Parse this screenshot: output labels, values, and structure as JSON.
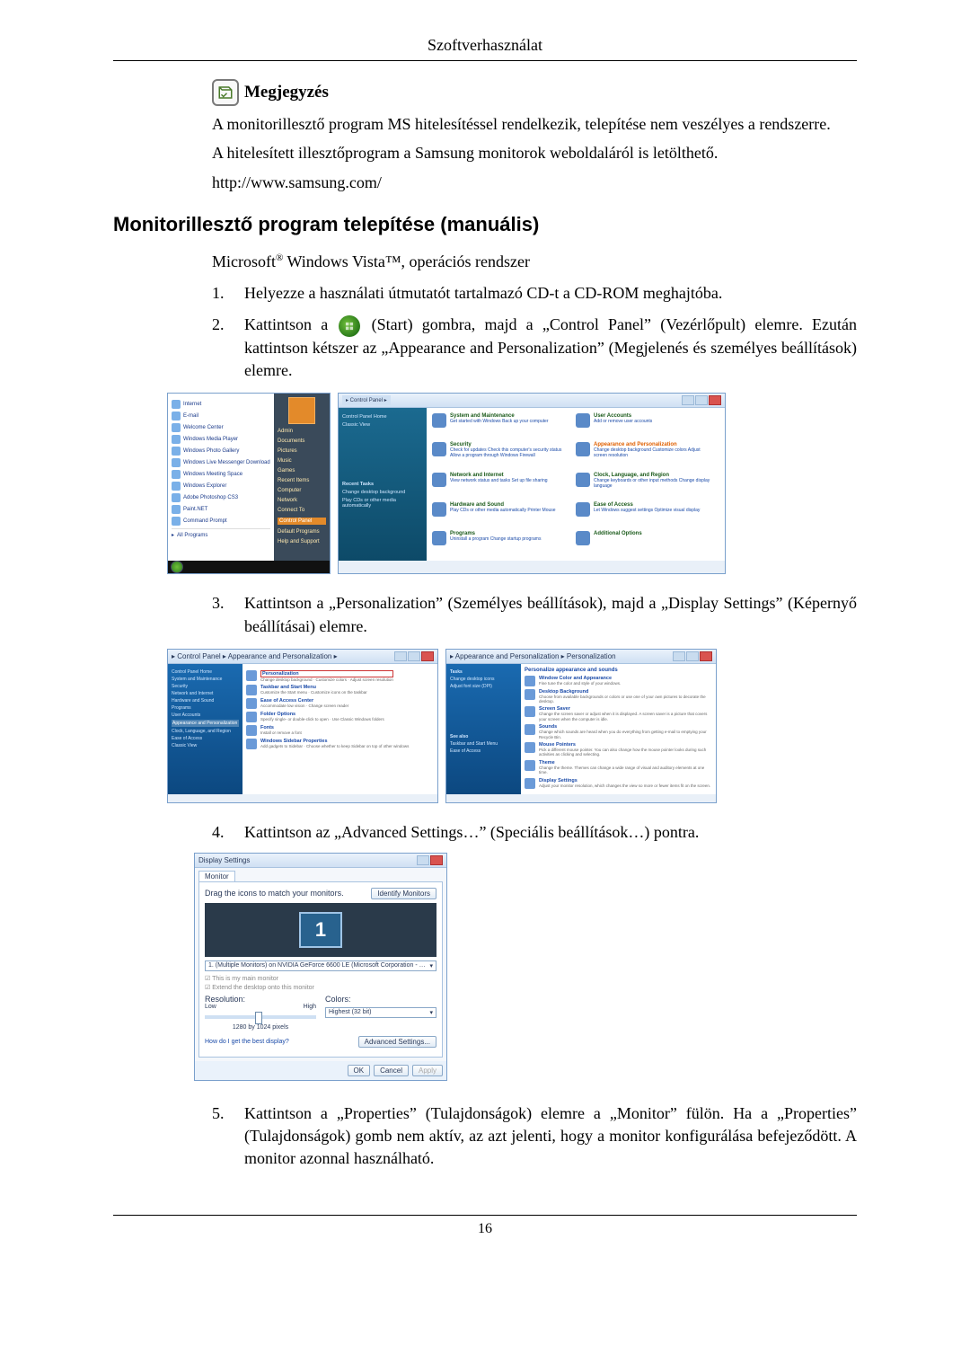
{
  "header": {
    "title": "Szoftverhasználat"
  },
  "note": {
    "label": "Megjegyzés",
    "lines": [
      "A monitorillesztő program MS hitelesítéssel rendelkezik, telepítése nem veszélyes a rendszerre.",
      "A hitelesített illesztőprogram a Samsung monitorok weboldaláról is letölthető.",
      "http://www.samsung.com/"
    ]
  },
  "section_title": "Monitorillesztő program telepítése (manuális)",
  "intro_prefix": "Microsoft",
  "intro_suffix": " Windows Vista™, operációs rendszer",
  "steps": {
    "s1": {
      "num": "1.",
      "text": "Helyezze a használati útmutatót tartalmazó CD-t a CD-ROM meghajtóba."
    },
    "s2": {
      "num": "2.",
      "before": "Kattintson a ",
      "after": "(Start) gombra, majd a „Control Panel” (Vezérlőpult) elemre. Ezután kattintson kétszer az „Appearance and Personalization” (Megjelenés és személyes beállítások) elemre."
    },
    "s3": {
      "num": "3.",
      "text": "Kattintson a „Personalization” (Személyes beállítások), majd a „Display Settings” (Képernyő beállításai) elemre."
    },
    "s4": {
      "num": "4.",
      "text": "Kattintson az „Advanced Settings…” (Speciális beállítások…) pontra."
    },
    "s5": {
      "num": "5.",
      "text": "Kattintson a „Properties” (Tulajdonságok) elemre a „Monitor” fülön. Ha a „Properties” (Tulajdonságok) gomb nem aktív, az azt jelenti, hogy a monitor konfigurálása befejeződött. A monitor azonnal használható."
    }
  },
  "start_menu": {
    "left_items": [
      "Internet",
      "E-mail",
      "Welcome Center",
      "Windows Media Player",
      "Windows Photo Gallery",
      "Windows Live Messenger Download",
      "Windows Meeting Space",
      "Windows Explorer",
      "Adobe Photoshop CS3",
      "Paint.NET",
      "Command Prompt"
    ],
    "all_programs": "All Programs",
    "right_items": [
      "Documents",
      "Pictures",
      "Music",
      "Games",
      "Recent Items",
      "Computer",
      "Network",
      "Connect To",
      "Control Panel",
      "Default Programs",
      "Help and Support"
    ],
    "user_label": "Admin"
  },
  "control_panel": {
    "breadcrumb": "▸ Control Panel ▸",
    "side": [
      "Control Panel Home",
      "Classic View"
    ],
    "side_tasks": "Recent Tasks",
    "side_tasks_items": [
      "Change desktop background",
      "Play CDs or other media automatically"
    ],
    "cats": [
      {
        "h": "System and Maintenance",
        "s": "Get started with Windows\nBack up your computer"
      },
      {
        "h": "User Accounts",
        "s": "Add or remove user accounts"
      },
      {
        "h": "Security",
        "s": "Check for updates\nCheck this computer's security status\nAllow a program through Windows Firewall"
      },
      {
        "h": "Appearance and Personalization",
        "s": "Change desktop background\nCustomize colors\nAdjust screen resolution"
      },
      {
        "h": "Network and Internet",
        "s": "View network status and tasks\nSet up file sharing"
      },
      {
        "h": "Clock, Language, and Region",
        "s": "Change keyboards or other input methods\nChange display language"
      },
      {
        "h": "Hardware and Sound",
        "s": "Play CDs or other media automatically\nPrinter\nMouse"
      },
      {
        "h": "Ease of Access",
        "s": "Let Windows suggest settings\nOptimize visual display"
      },
      {
        "h": "Programs",
        "s": "Uninstall a program\nChange startup programs"
      },
      {
        "h": "Additional Options",
        "s": ""
      }
    ]
  },
  "appearance_panel": {
    "breadcrumb": "▸ Control Panel ▸ Appearance and Personalization ▸",
    "side": [
      "Control Panel Home",
      "System and Maintenance",
      "Security",
      "Network and Internet",
      "Hardware and Sound",
      "Programs",
      "User Accounts",
      "Appearance and Personalization",
      "Clock, Language, and Region",
      "Ease of Access",
      "Classic View"
    ],
    "items": [
      {
        "h": "Personalization",
        "s": "Change desktop background · Customize colors · Adjust screen resolution"
      },
      {
        "h": "Taskbar and Start Menu",
        "s": "Customize the Start menu · Customize icons on the taskbar"
      },
      {
        "h": "Ease of Access Center",
        "s": "Accommodate low vision · Change screen reader"
      },
      {
        "h": "Folder Options",
        "s": "Specify single- or double-click to open · Use Classic Windows folders"
      },
      {
        "h": "Fonts",
        "s": "Install or remove a font"
      },
      {
        "h": "Windows Sidebar Properties",
        "s": "Add gadgets to Sidebar · Choose whether to keep Sidebar on top of other windows"
      }
    ]
  },
  "personalization_panel": {
    "breadcrumb": "▸ Appearance and Personalization ▸ Personalization",
    "side": [
      "Tasks",
      "Change desktop icons",
      "Adjust font size (DPI)"
    ],
    "heading": "Personalize appearance and sounds",
    "items": [
      {
        "h": "Window Color and Appearance",
        "s": "Fine tune the color and style of your windows."
      },
      {
        "h": "Desktop Background",
        "s": "Choose from available backgrounds or colors or use one of your own pictures to decorate the desktop."
      },
      {
        "h": "Screen Saver",
        "s": "Change the screen saver or adjust when it is displayed. A screen saver is a picture that covers your screen when the computer is idle."
      },
      {
        "h": "Sounds",
        "s": "Change which sounds are heard when you do everything from getting e-mail to emptying your Recycle Bin."
      },
      {
        "h": "Mouse Pointers",
        "s": "Pick a different mouse pointer. You can also change how the mouse pointer looks during such activities as clicking and selecting."
      },
      {
        "h": "Theme",
        "s": "Change the theme. Themes can change a wide range of visual and auditory elements at one time."
      },
      {
        "h": "Display Settings",
        "s": "Adjust your monitor resolution, which changes the view so more or fewer items fit on the screen."
      }
    ],
    "see_also": "See also",
    "see_items": [
      "Taskbar and Start Menu",
      "Ease of Access"
    ]
  },
  "display_settings": {
    "title": "Display Settings",
    "tab": "Monitor",
    "drag_text": "Drag the icons to match your monitors.",
    "identify": "Identify Monitors",
    "monitor_num": "1",
    "adapter_text": "1. (Multiple Monitors) on NVIDIA GeForce 6600 LE (Microsoft Corporation - …",
    "check_main": "This is my main monitor",
    "check_extend": "Extend the desktop onto this monitor",
    "res_label": "Resolution:",
    "low": "Low",
    "high": "High",
    "res_value": "1280 by 1024 pixels",
    "colors_label": "Colors:",
    "colors_value": "Highest (32 bit)",
    "help_link": "How do I get the best display?",
    "adv_btn": "Advanced Settings...",
    "ok": "OK",
    "cancel": "Cancel",
    "apply": "Apply"
  },
  "page_number": "16"
}
